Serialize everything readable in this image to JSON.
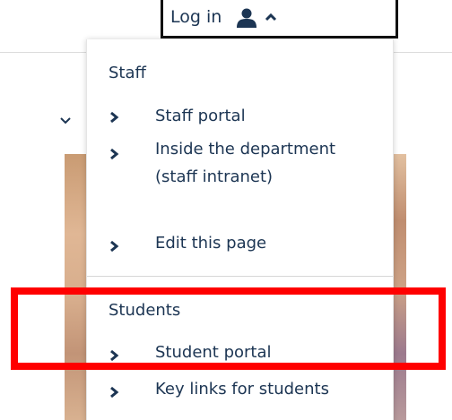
{
  "login": {
    "label": "Log in",
    "user_icon": "user-icon",
    "caret_icon": "caret-up-icon"
  },
  "menu": {
    "sections": [
      {
        "heading": "Staff",
        "items": [
          {
            "label": "Staff portal"
          },
          {
            "label": "Inside the department (staff intranet)"
          },
          {
            "label": "Edit this page"
          }
        ]
      },
      {
        "heading": "Students",
        "items": [
          {
            "label": "Student portal"
          },
          {
            "label": "Key links for students"
          }
        ]
      }
    ]
  },
  "colors": {
    "text": "#1c3553",
    "highlight": "#ff0000"
  }
}
